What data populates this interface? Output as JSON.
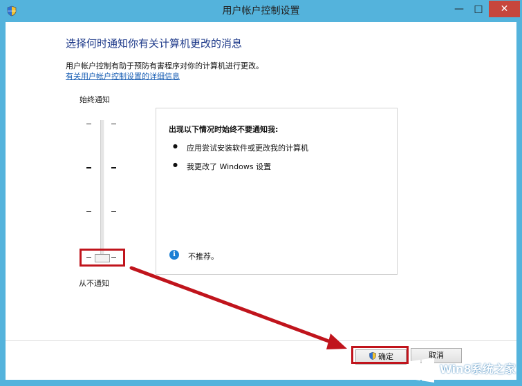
{
  "window": {
    "title": "用户帐户控制设置",
    "min_glyph": "—",
    "max_glyph": "□",
    "close_glyph": "✕"
  },
  "header": {
    "heading": "选择何时通知你有关计算机更改的消息",
    "description": "用户帐户控制有助于预防有害程序对你的计算机进行更改。",
    "link": "有关用户帐户控制设置的详细信息"
  },
  "slider": {
    "top_label": "始终通知",
    "bottom_label": "从不通知",
    "levels": 4,
    "selected_level": 1
  },
  "panel": {
    "title": "出现以下情况时始终不要通知我:",
    "bullets": [
      "应用尝试安装软件或更改我的计算机",
      "我更改了 Windows 设置"
    ],
    "bullet_glyph": "●",
    "info_glyph": "i",
    "info_text": "不推荐。"
  },
  "buttons": {
    "ok": "确定",
    "cancel": "取消"
  },
  "watermark": {
    "text": "Win8系统之家"
  },
  "colors": {
    "frame": "#54b3dc",
    "close": "#c7463c",
    "highlight": "#c0141c",
    "heading": "#1e3a8a",
    "link": "#1a5fb4"
  },
  "icons": {
    "app": "uac-shield-icon",
    "ok": "uac-shield-icon",
    "info": "info-icon",
    "watermark": "windows-logo-icon"
  }
}
